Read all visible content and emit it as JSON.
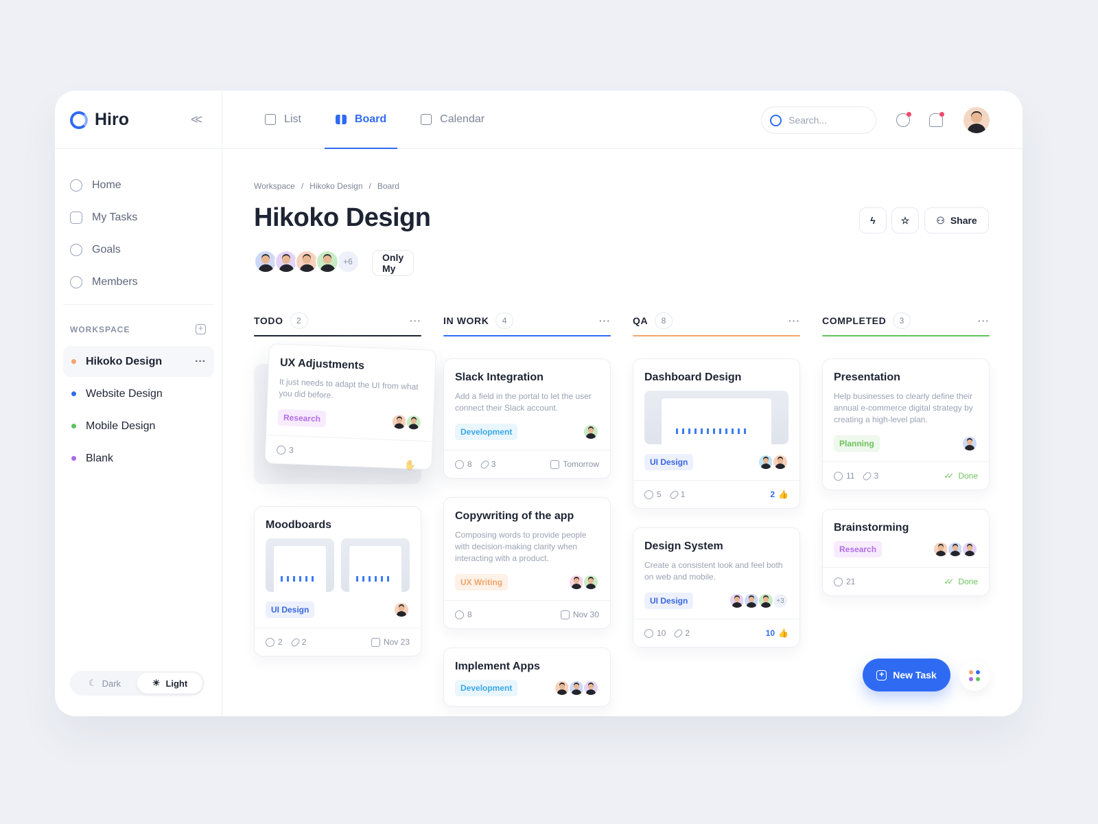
{
  "app": {
    "name": "Hiro"
  },
  "sidebar": {
    "items": [
      {
        "label": "Home",
        "icon": "home-icon"
      },
      {
        "label": "My Tasks",
        "icon": "check-square-icon"
      },
      {
        "label": "Goals",
        "icon": "trophy-icon"
      },
      {
        "label": "Members",
        "icon": "users-icon"
      }
    ],
    "workspace_title": "WORKSPACE",
    "workspaces": [
      {
        "label": "Hikoko Design",
        "color": "#f5a56a",
        "active": true
      },
      {
        "label": "Website Design",
        "color": "#2f6bf2"
      },
      {
        "label": "Mobile Design",
        "color": "#5cc45c"
      },
      {
        "label": "Blank",
        "color": "#a86ae8"
      }
    ],
    "theme": {
      "dark": "Dark",
      "light": "Light",
      "selected": "Light"
    }
  },
  "header": {
    "tabs": [
      {
        "label": "List",
        "active": false
      },
      {
        "label": "Board",
        "active": true
      },
      {
        "label": "Calendar",
        "active": false
      }
    ],
    "search_placeholder": "Search..."
  },
  "page": {
    "breadcrumb": [
      "Workspace",
      "Hikoko Design",
      "Board"
    ],
    "title": "Hikoko Design",
    "members_more": "+6",
    "only_my": "Only My",
    "share": "Share"
  },
  "colors": {
    "accent": "#2f6bf2"
  },
  "tags": {
    "Research": [
      "#f7ecfd",
      "#b26ee6"
    ],
    "Development": [
      "#eaf6fd",
      "#3aa8e8"
    ],
    "UI Design": [
      "#edf1fd",
      "#3a66e0"
    ],
    "UX Writing": [
      "#fdf1e8",
      "#f0a46a"
    ],
    "Planning": [
      "#eef8ec",
      "#6cc25c"
    ]
  },
  "columns": [
    {
      "name": "TODO",
      "count": "2",
      "color": "#1d2433",
      "cards": [
        {
          "title": "UX Adjustments",
          "desc": "It just needs to adapt the UI from what you did before.",
          "tag": "Research",
          "avatars": [
            "#f6d1bd",
            "#c9ebc4"
          ],
          "comments": "3",
          "dragging": true
        },
        {
          "title": "Moodboards",
          "images": 2,
          "tag": "UI Design",
          "avatars": [
            "#f6d1bd"
          ],
          "comments": "2",
          "links": "2",
          "date": "Nov 23"
        }
      ]
    },
    {
      "name": "IN WORK",
      "count": "4",
      "color": "#2f6bf2",
      "cards": [
        {
          "title": "Slack Integration",
          "desc": "Add a field in the portal to let the user connect their Slack account.",
          "tag": "Development",
          "avatars": [
            "#c9ebc4"
          ],
          "comments": "8",
          "links": "3",
          "date": "Tomorrow"
        },
        {
          "title": "Copywriting of the app",
          "desc": "Composing words to provide people with decision-making clarity when interacting with a product.",
          "tag": "UX Writing",
          "avatars": [
            "#f7d3e3",
            "#c9ebc4"
          ],
          "comments": "8",
          "date": "Nov 30"
        },
        {
          "title": "Implement Apps",
          "tag": "Development",
          "avatars": [
            "#f6d1bd",
            "#cdd9f6",
            "#e4d3f6"
          ]
        }
      ]
    },
    {
      "name": "QA",
      "count": "8",
      "color": "#f5a56a",
      "cards": [
        {
          "title": "Dashboard Design",
          "images": 1,
          "tag": "UI Design",
          "avatars": [
            "#bfe3f6",
            "#f6d1bd"
          ],
          "comments": "5",
          "links": "1",
          "likes": "2"
        },
        {
          "title": "Design System",
          "desc": "Create a consistent look and feel both on web and mobile.",
          "tag": "UI Design",
          "avatars": [
            "#e4d3f6",
            "#cdd9f6",
            "#c9ebc4"
          ],
          "avatars_more": "+3",
          "comments": "10",
          "links": "2",
          "likes": "10"
        }
      ]
    },
    {
      "name": "COMPLETED",
      "count": "3",
      "color": "#5cc45c",
      "cards": [
        {
          "title": "Presentation",
          "desc": "Help businesses to clearly define their annual e-commerce digital strategy by creating a high-level plan.",
          "tag": "Planning",
          "avatars": [
            "#cdd9f6"
          ],
          "comments": "11",
          "links": "3",
          "status": "Done"
        },
        {
          "title": "Brainstorming",
          "tag": "Research",
          "avatars": [
            "#f6d1bd",
            "#cdd9f6",
            "#e4d3f6"
          ],
          "comments": "21",
          "status": "Done"
        }
      ]
    }
  ],
  "fab": {
    "new_task": "New Task"
  }
}
